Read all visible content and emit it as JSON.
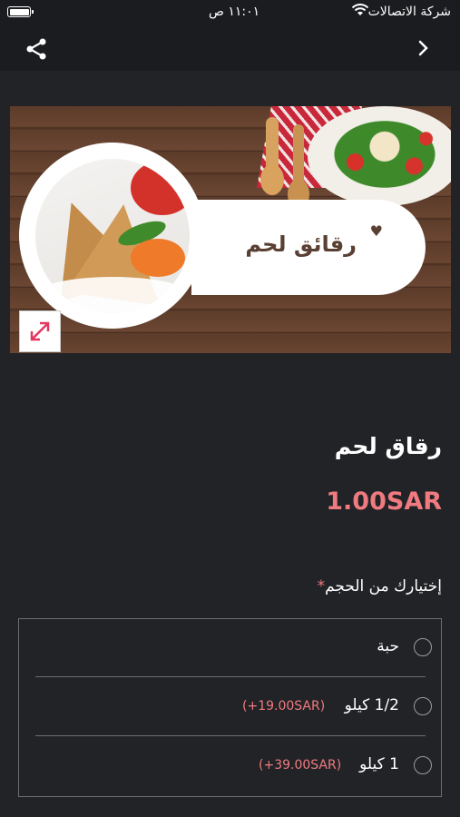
{
  "status_bar": {
    "carrier": "شركة الاتصالات",
    "time": "١١:٠١ ص"
  },
  "nav": {
    "share_icon": "share-icon",
    "back_icon": "chevron-right-icon"
  },
  "hero": {
    "overlay_title": "رقائق لحم",
    "heart": "♥"
  },
  "product": {
    "title": "رقاق لحم",
    "price": "1.00SAR"
  },
  "options": {
    "label": "إختيارك من الحجم",
    "required_marker": "*",
    "items": [
      {
        "name": "حبة",
        "extra": ""
      },
      {
        "name": "1/2 كيلو",
        "extra": "(+19.00SAR)"
      },
      {
        "name": "1 كيلو",
        "extra": "(+39.00SAR)"
      }
    ]
  },
  "colors": {
    "accent": "#ef7a7f",
    "background": "#222327",
    "bar": "#1b1c1f"
  }
}
